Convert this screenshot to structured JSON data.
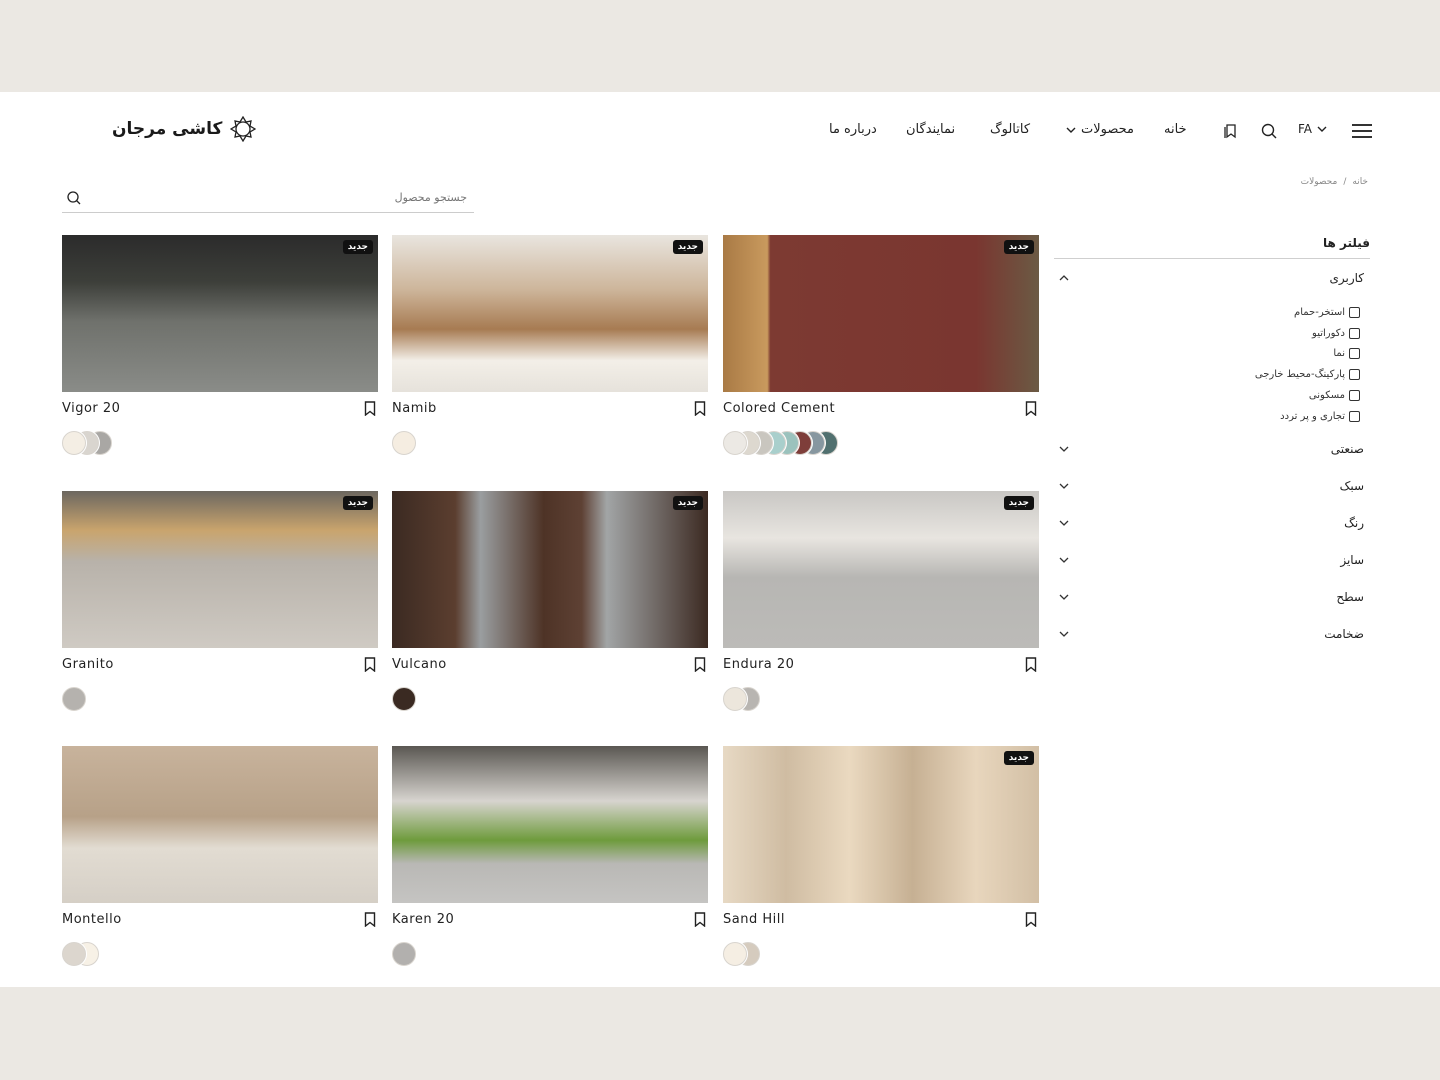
{
  "header": {
    "brand": "کاشی مرجان",
    "lang": "FA",
    "nav": {
      "home": "خانه",
      "products": "محصولات",
      "catalog": "کاتالوگ",
      "dealers": "نمایندگان",
      "about": "درباره ما"
    }
  },
  "breadcrumb": {
    "home": "خانه",
    "sep": "/",
    "current": "محصولات"
  },
  "search": {
    "placeholder": "جستجو محصول"
  },
  "badge_label": "جدید",
  "products": [
    {
      "name": "Vigor 20",
      "new": true,
      "swatches": [
        "#f4eee4",
        "#d9d5cf",
        "#a9a7a4"
      ]
    },
    {
      "name": "Namib",
      "new": true,
      "swatches": [
        "#f5ede1"
      ]
    },
    {
      "name": "Colored Cement",
      "new": true,
      "swatches": [
        "#ece9e4",
        "#ddd8cf",
        "#c9c6bf",
        "#a9cfcc",
        "#9bc2bd",
        "#7e3e3a",
        "#8797a0",
        "#51706f"
      ]
    },
    {
      "name": "Granito",
      "new": true,
      "swatches": [
        "#b5b2ae"
      ]
    },
    {
      "name": "Vulcano",
      "new": true,
      "swatches": [
        "#3a2a22"
      ]
    },
    {
      "name": "Endura 20",
      "new": true,
      "swatches": [
        "#ece6dc",
        "#b8b5b1"
      ]
    },
    {
      "name": "Montello",
      "new": false,
      "swatches": [
        "#dcd6ce",
        "#f7f1e6"
      ]
    },
    {
      "name": "Karen 20",
      "new": false,
      "swatches": [
        "#b2b0ae"
      ]
    },
    {
      "name": "Sand Hill",
      "new": true,
      "swatches": [
        "#f5eee3",
        "#d5cbbe"
      ]
    }
  ],
  "filters": {
    "title": "فیلتر ها",
    "usage": {
      "label": "کاربری",
      "options": [
        "استخر-حمام",
        "دکوراتیو",
        "نما",
        "پارکینگ-محیط خارجی",
        "مسکونی",
        "تجاری و پر تردد"
      ]
    },
    "industrial": "صنعتی",
    "style": "سبک",
    "color": "رنگ",
    "size": "سایز",
    "surface": "سطح",
    "thickness": "ضخامت"
  }
}
